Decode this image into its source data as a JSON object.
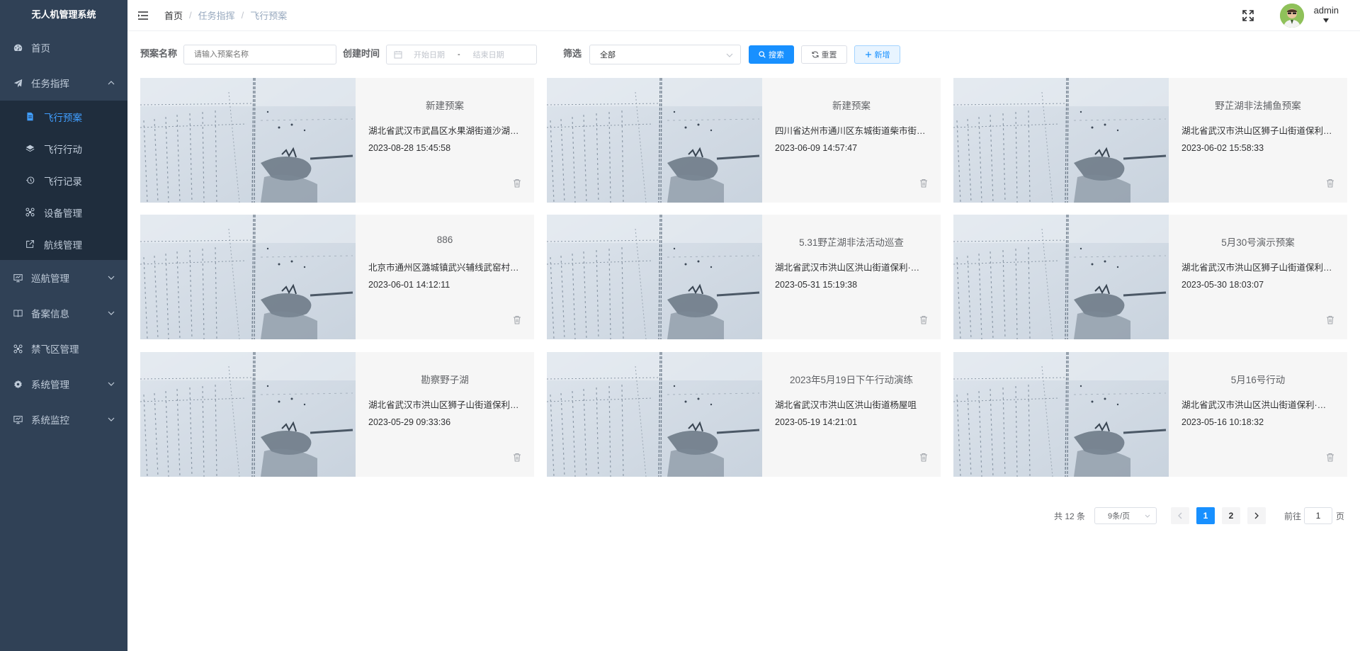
{
  "app": {
    "title": "无人机管理系统"
  },
  "sidebar": {
    "items": [
      {
        "label": "首页",
        "icon": "dashboard-icon"
      },
      {
        "label": "任务指挥",
        "icon": "send-icon",
        "expanded": true,
        "children": [
          {
            "label": "飞行预案",
            "icon": "document-icon",
            "active": true
          },
          {
            "label": "飞行行动",
            "icon": "layers-icon"
          },
          {
            "label": "飞行记录",
            "icon": "history-icon"
          },
          {
            "label": "设备管理",
            "icon": "drone-icon"
          },
          {
            "label": "航线管理",
            "icon": "external-link-icon"
          }
        ]
      },
      {
        "label": "巡航管理",
        "icon": "monitor-icon"
      },
      {
        "label": "备案信息",
        "icon": "book-icon"
      },
      {
        "label": "禁飞区管理",
        "icon": "drone-icon"
      },
      {
        "label": "系统管理",
        "icon": "gear-icon"
      },
      {
        "label": "系统监控",
        "icon": "monitor-icon"
      }
    ]
  },
  "header": {
    "breadcrumb": [
      "首页",
      "任务指挥",
      "飞行预案"
    ],
    "user": "admin"
  },
  "search": {
    "name_label": "预案名称",
    "name_placeholder": "请输入预案名称",
    "time_label": "创建时间",
    "start_placeholder": "开始日期",
    "range_sep": "-",
    "end_placeholder": "结束日期",
    "filter_label": "筛选",
    "filter_value": "全部",
    "search_button": "搜索",
    "reset_button": "重置",
    "add_button": "新增"
  },
  "cards": [
    {
      "title": "新建预案",
      "address": "湖北省武汉市武昌区水果湖街道沙湖…",
      "time": "2023-08-28 15:45:58"
    },
    {
      "title": "新建预案",
      "address": "四川省达州市通川区东城街道柴市街…",
      "time": "2023-06-09 14:57:47"
    },
    {
      "title": "野芷湖非法捕鱼预案",
      "address": "湖北省武汉市洪山区狮子山街道保利…",
      "time": "2023-06-02 15:58:33"
    },
    {
      "title": "886",
      "address": "北京市通州区潞城镇武兴辅线武窑村…",
      "time": "2023-06-01 14:12:11"
    },
    {
      "title": "5.31野芷湖非法活动巡查",
      "address": "湖北省武汉市洪山区洪山街道保利·…",
      "time": "2023-05-31 15:19:38"
    },
    {
      "title": "5月30号演示预案",
      "address": "湖北省武汉市洪山区狮子山街道保利…",
      "time": "2023-05-30 18:03:07"
    },
    {
      "title": "勘察野子湖",
      "address": "湖北省武汉市洪山区狮子山街道保利…",
      "time": "2023-05-29 09:33:36"
    },
    {
      "title": "2023年5月19日下午行动演练",
      "address": "湖北省武汉市洪山区洪山街道杨屋咀",
      "time": "2023-05-19 14:21:01"
    },
    {
      "title": "5月16号行动",
      "address": "湖北省武汉市洪山区洪山街道保利·…",
      "time": "2023-05-16 10:18:32"
    }
  ],
  "pagination": {
    "total": "共 12 条",
    "page_size": "9条/页",
    "pages": [
      "1",
      "2"
    ],
    "current": "1",
    "goto_label": "前往",
    "goto_value": "1",
    "goto_suffix": "页"
  },
  "colors": {
    "sidebar_bg": "#304156",
    "submenu_bg": "#1f2d3d",
    "accent": "#1890ff",
    "active_text": "#409eff"
  }
}
